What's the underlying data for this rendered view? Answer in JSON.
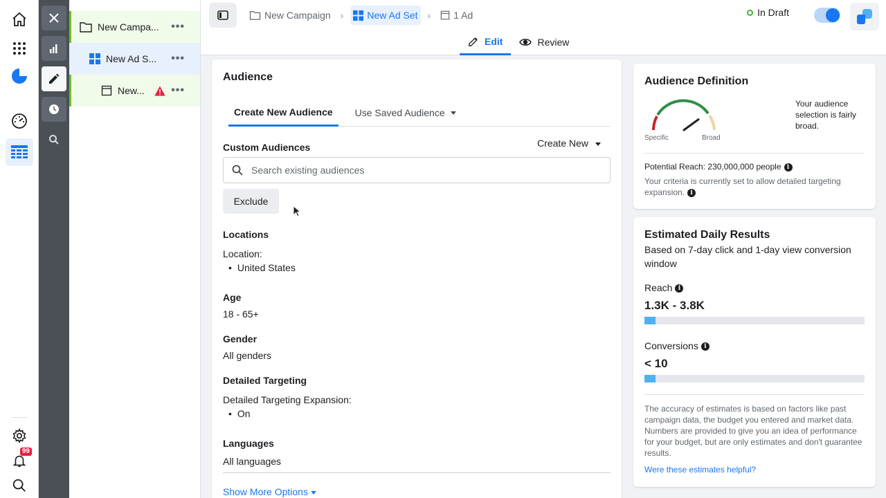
{
  "rail": {
    "notification_count": "99"
  },
  "tree": {
    "campaign": "New Campa...",
    "adset": "New Ad S...",
    "ad": "New..."
  },
  "header": {
    "breadcrumbs": [
      "New Campaign",
      "New Ad Set",
      "1 Ad"
    ],
    "status": "In Draft",
    "tabs": [
      "Edit",
      "Review"
    ]
  },
  "audience": {
    "title": "Audience",
    "tabs": [
      "Create New Audience",
      "Use Saved Audience"
    ],
    "custom_label": "Custom Audiences",
    "create_new": "Create New",
    "search_placeholder": "Search existing audiences",
    "exclude": "Exclude",
    "locations_label": "Locations",
    "location_sub": "Location:",
    "location_value": "United States",
    "age_label": "Age",
    "age_value": "18 - 65+",
    "gender_label": "Gender",
    "gender_value": "All genders",
    "detailed_label": "Detailed Targeting",
    "expansion_label": "Detailed Targeting Expansion:",
    "expansion_value": "On",
    "languages_label": "Languages",
    "languages_value": "All languages",
    "show_more": "Show More Options"
  },
  "definition": {
    "title": "Audience Definition",
    "gauge_left": "Specific",
    "gauge_right": "Broad",
    "gauge_needle_level": 0.8,
    "summary": "Your audience selection is fairly broad.",
    "potential_reach": "Potential Reach: 230,000,000 people",
    "criteria_note": "Your criteria is currently set to allow detailed targeting expansion."
  },
  "estimates": {
    "title": "Estimated Daily Results",
    "subtitle": "Based on 7-day click and 1-day view conversion window",
    "reach_label": "Reach",
    "reach_value": "1.3K - 3.8K",
    "reach_fill": 0.05,
    "conversions_label": "Conversions",
    "conversions_value": "< 10",
    "conversions_fill": 0.05,
    "disclaimer": "The accuracy of estimates is based on factors like past campaign data, the budget you entered and market data. Numbers are provided to give you an idea of performance for your budget, but are only estimates and don't guarantee results.",
    "feedback_link": "Were these estimates helpful?"
  },
  "colors": {
    "accent": "#1877f2",
    "draft_green": "#42b72a",
    "bar_fill": "#4fb1f1"
  }
}
